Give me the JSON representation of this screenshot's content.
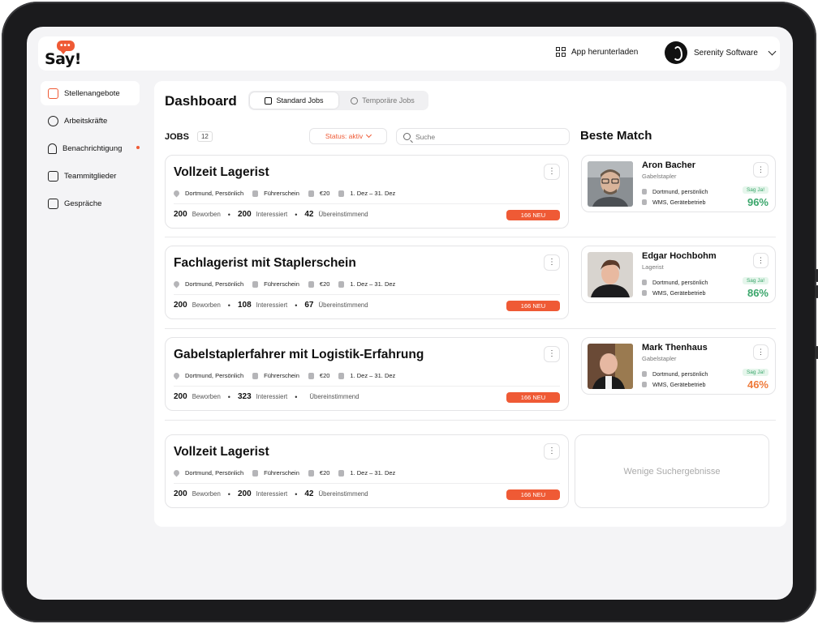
{
  "brand": {
    "logo_text": "Say!",
    "logo_dots": "•••",
    "accent_color": "#ef5a35"
  },
  "topbar": {
    "app_download": "App herunterladen",
    "company": "Serenity Software"
  },
  "sidebar": {
    "items": [
      {
        "label": "Stellenangebote",
        "icon": "jobs-icon",
        "active": true
      },
      {
        "label": "Arbeitskräfte",
        "icon": "user-icon"
      },
      {
        "label": "Benachrichtigung",
        "icon": "bell-icon",
        "has_dot": true
      },
      {
        "label": "Teammitglieder",
        "icon": "id-card-icon"
      },
      {
        "label": "Gespräche",
        "icon": "mail-icon"
      }
    ]
  },
  "main": {
    "title": "Dashboard",
    "tabs": [
      {
        "label": "Standard Jobs",
        "icon": "briefcase-icon",
        "active": true
      },
      {
        "label": "Temporäre Jobs",
        "icon": "clock-icon"
      }
    ],
    "jobs_label": "JOBS",
    "jobs_count": "12",
    "status_filter": "Status: aktiv",
    "search_placeholder": "Suche",
    "best_match_title": "Beste Match",
    "empty_text": "Wenige Suchergebnisse"
  },
  "jobs": [
    {
      "title": "Vollzeit Lagerist",
      "location": "Dortmund, Persönlich",
      "license": "Führerschein",
      "pay": "€20",
      "dates": "1. Dez – 31. Dez",
      "applied": "200",
      "applied_label": "Beworben",
      "interested": "200",
      "interested_label": "Interessiert",
      "match": "42",
      "match_label": "Übereinstimmend",
      "badge": "166 NEU"
    },
    {
      "title": "Fachlagerist mit Staplerschein",
      "location": "Dortmund, Persönlich",
      "license": "Führerschein",
      "pay": "€20",
      "dates": "1. Dez – 31. Dez",
      "applied": "200",
      "applied_label": "Beworben",
      "interested": "108",
      "interested_label": "Interessiert",
      "match": "67",
      "match_label": "Übereinstimmend",
      "badge": "166 NEU"
    },
    {
      "title": "Gabelstaplerfahrer mit Logistik-Erfahrung",
      "location": "Dortmund, Persönlich",
      "license": "Führerschein",
      "pay": "€20",
      "dates": "1. Dez – 31. Dez",
      "applied": "200",
      "applied_label": "Beworben",
      "interested": "323",
      "interested_label": "Interessiert",
      "match": "",
      "match_label": "Übereinstimmend",
      "badge": "166 NEU"
    },
    {
      "title": "Vollzeit Lagerist",
      "location": "Dortmund, Persönlich",
      "license": "Führerschein",
      "pay": "€20",
      "dates": "1. Dez – 31. Dez",
      "applied": "200",
      "applied_label": "Beworben",
      "interested": "200",
      "interested_label": "Interessiert",
      "match": "42",
      "match_label": "Übereinstimmend",
      "badge": "166 NEU"
    }
  ],
  "matches": [
    {
      "name": "Aron Bacher",
      "role": "Gabelstapler",
      "location": "Dortmund, persönlich",
      "skills": "WMS, Gerätebetrieb",
      "cta": "Sag Ja!",
      "percent": "96%",
      "percent_color": "#3aa66b"
    },
    {
      "name": "Edgar Hochbohm",
      "role": "Lagerist",
      "location": "Dortmund, persönlich",
      "skills": "WMS, Gerätebetrieb",
      "cta": "Sag Ja!",
      "percent": "86%",
      "percent_color": "#3aa66b"
    },
    {
      "name": "Mark Thenhaus",
      "role": "Gabelstapler",
      "location": "Dortmund, persönlich",
      "skills": "WMS, Gerätebetrieb",
      "cta": "Sag Ja!",
      "percent": "46%",
      "percent_color": "#ef7a3a"
    }
  ]
}
